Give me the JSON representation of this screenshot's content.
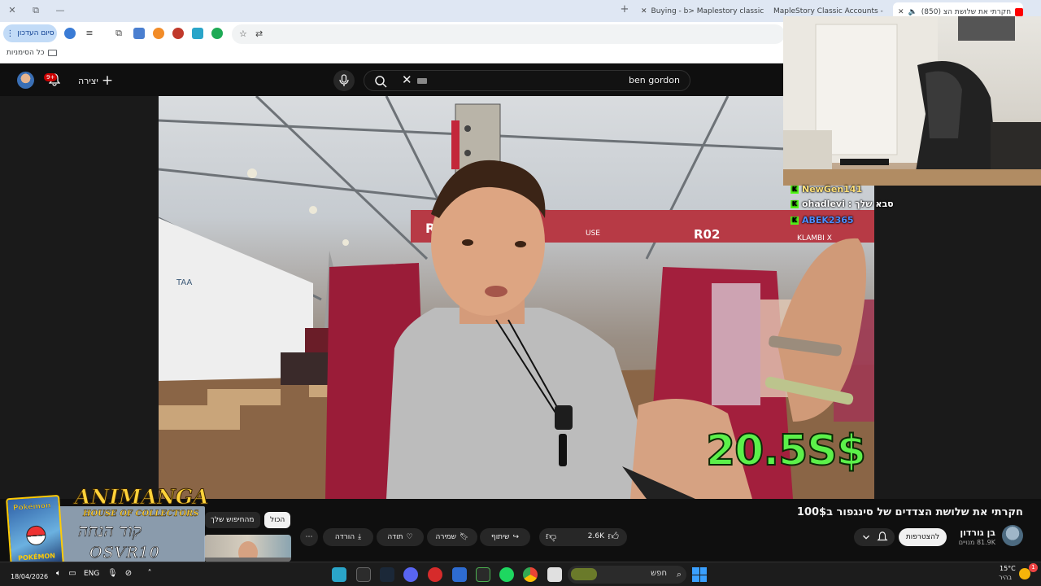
{
  "browser": {
    "window_controls": {
      "close": "✕",
      "restore": "⧉",
      "minimize": "—"
    },
    "tabs": [
      {
        "title": "Buying - b> Maplestory classic",
        "favicon_color": "#e8b400"
      },
      {
        "title": "MapleStory Classic Accounts -",
        "favicon_color": "#2a6fd6"
      },
      {
        "title": "(850) חקרתי את שלושת הצ",
        "favicon_color": "#ff0000",
        "active": true
      }
    ],
    "new_tab": "+",
    "finish_label": "סיום העדכון",
    "bookmarks_label": "כל הסימניות"
  },
  "youtube_header": {
    "search_query": "ben gordon",
    "create_label": "יצירה",
    "notifications_badge": "9+"
  },
  "video": {
    "overlay_price": "20.5S$",
    "booth_sign_left": "R01",
    "booth_sign_right": "R02",
    "booth_brand": "KLAMBI X",
    "booth_house": "USE",
    "tent_sign": "TAA"
  },
  "stream_chat": [
    {
      "name": "NewGen141",
      "message": ""
    },
    {
      "name": "ohadlevi",
      "message": "סבא שלך"
    },
    {
      "name": "ABEK2365",
      "message": ""
    }
  ],
  "below_video": {
    "title": "חקרתי את שלושת הצדדים של סינגפור ב100$",
    "channel_name": "בן גורדון",
    "channel_subs": "81.9K מנויים",
    "join_label": "להצטרפות",
    "like_count": "2.6K",
    "share_label": "שיתוף",
    "save_label": "שמירה",
    "thanks_label": "תודה",
    "download_label": "הורדה",
    "more_label": "⋯",
    "chips": [
      "הכול",
      "מהחיפוש שלך"
    ]
  },
  "sponsor": {
    "card_brand": "Pokémon",
    "card_sub": "POKÉMON",
    "brand": "ANIMANGA",
    "tagline": "HOUSE OF COLLECTORS",
    "code_label": "קוד הנחה",
    "code": "OSVR10"
  },
  "taskbar": {
    "date": "18/04/2026",
    "lang": "ENG",
    "search_placeholder": "חפש",
    "weather_temp": "15°C",
    "weather_desc": "בהיר",
    "notif_count": "1"
  },
  "colors": {
    "accent_green": "#5cf04a",
    "kick_green": "#53fc18",
    "youtube_red": "#ff0000",
    "chrome_blue": "#c2dbf7"
  }
}
